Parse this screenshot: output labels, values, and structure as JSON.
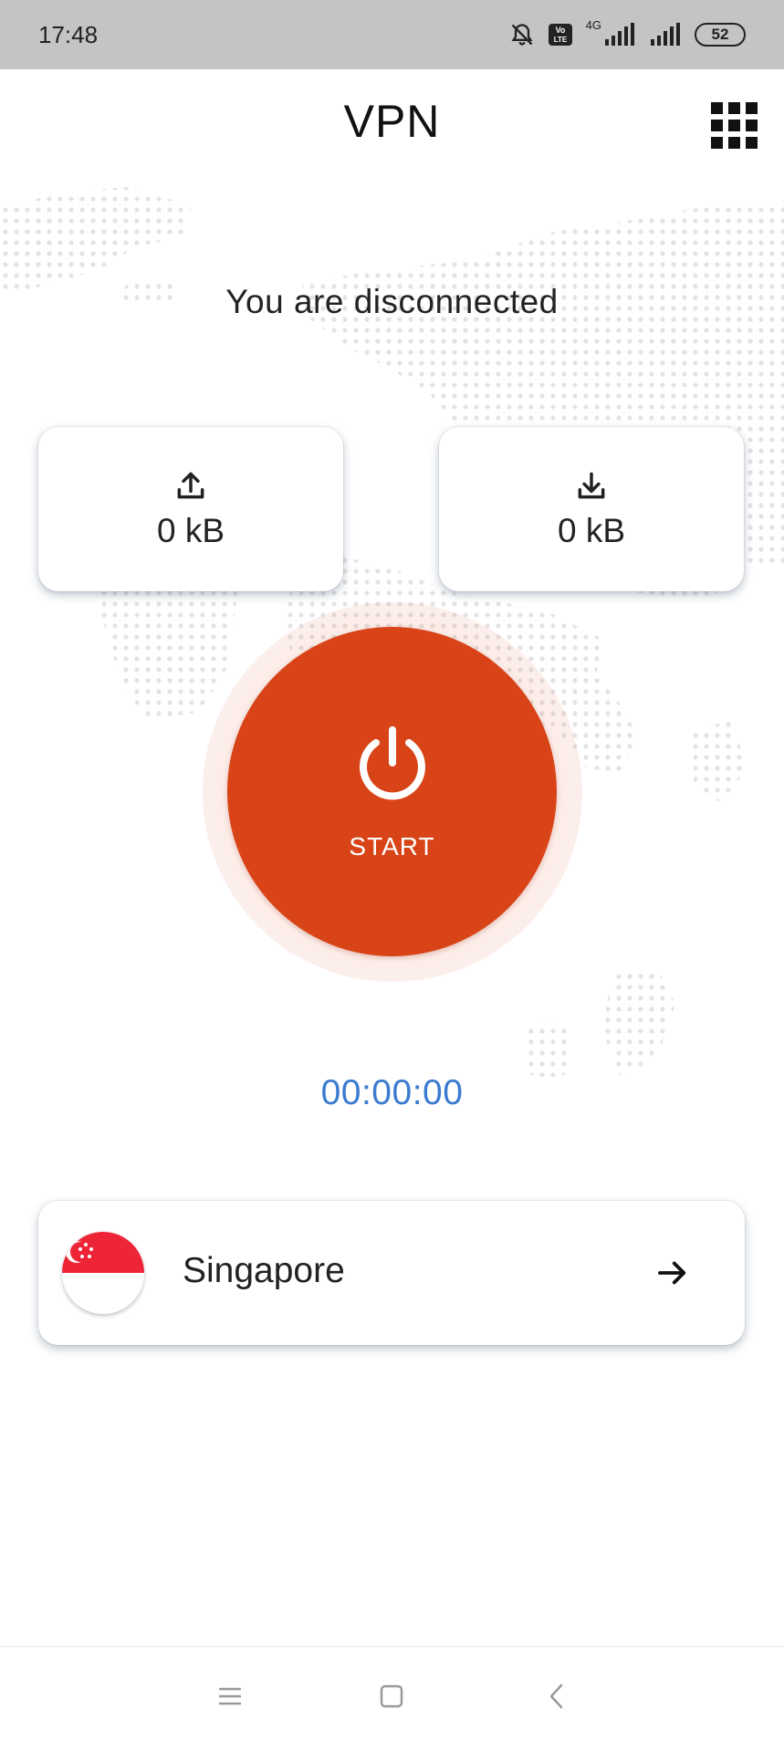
{
  "status_bar": {
    "time": "17:48",
    "network": "4G",
    "battery": "52"
  },
  "header": {
    "title": "VPN",
    "menu_icon": "grid-icon"
  },
  "connection": {
    "status_text": "You are disconnected",
    "upload": {
      "icon": "upload-icon",
      "value": "0 kB"
    },
    "download": {
      "icon": "download-icon",
      "value": "0 kB"
    },
    "power_label": "START",
    "timer": "00:00:00"
  },
  "server": {
    "name": "Singapore",
    "flag_icon": "singapore-flag-icon",
    "arrow_icon": "arrow-right-icon"
  },
  "colors": {
    "accent": "#d84417",
    "timer": "#3b7bd0",
    "status_bar": "#c4c4c4"
  }
}
